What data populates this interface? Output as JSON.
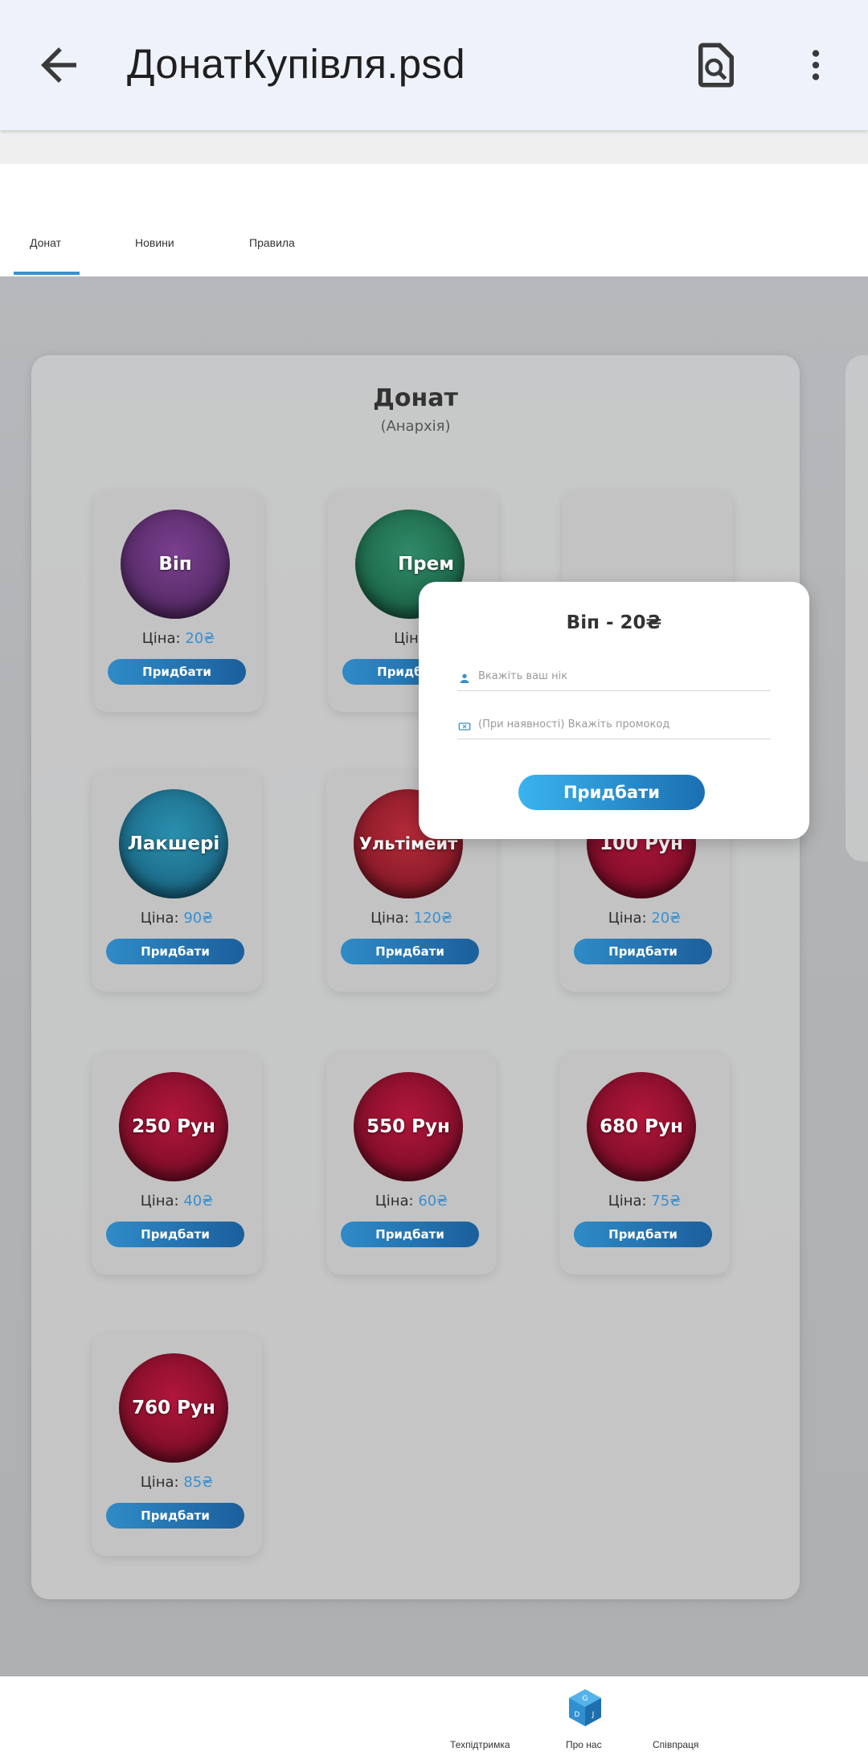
{
  "appbar": {
    "title": "ДонатКупівля.psd",
    "back_icon": "arrow-left-icon",
    "find_icon": "find-in-page-icon",
    "more_icon": "more-vert-icon"
  },
  "site_nav": {
    "items": [
      "Донат",
      "Новини",
      "Правила"
    ],
    "active": "Донат",
    "accent": "#3a8fd0"
  },
  "panel": {
    "title": "Донат",
    "subtitle": "(Анархія)"
  },
  "currency": "₴",
  "price_label": "Ціна:",
  "buy_label": "Придбати",
  "products": [
    {
      "name": "Віп",
      "price": "20₴",
      "color": "purple"
    },
    {
      "name": "Прем",
      "price": "",
      "color": "green"
    },
    {
      "name": "",
      "price": "",
      "color": "hidden"
    },
    {
      "name": "Лакшері",
      "price": "90₴",
      "color": "blue"
    },
    {
      "name": "Ультімейт",
      "price": "120₴",
      "color": "red"
    },
    {
      "name": "100 Рун",
      "price": "20₴",
      "color": "crimson"
    },
    {
      "name": "250 Рун",
      "price": "40₴",
      "color": "crimson"
    },
    {
      "name": "550 Рун",
      "price": "60₴",
      "color": "crimson"
    },
    {
      "name": "680 Рун",
      "price": "75₴",
      "color": "crimson"
    },
    {
      "name": "760 Рун",
      "price": "85₴",
      "color": "crimson"
    }
  ],
  "modal": {
    "title": "Віп - 20₴",
    "nick_placeholder": "Вкажіть ваш нік",
    "promo_placeholder": "(При наявності) Вкажіть промокод",
    "button": "Придбати",
    "nick_icon": "user-icon",
    "promo_icon": "ticket-icon"
  },
  "footer": {
    "links": [
      "Техпідтримка",
      "Про нас",
      "Співпраця"
    ],
    "logo_icon": "cube-logo-icon"
  }
}
